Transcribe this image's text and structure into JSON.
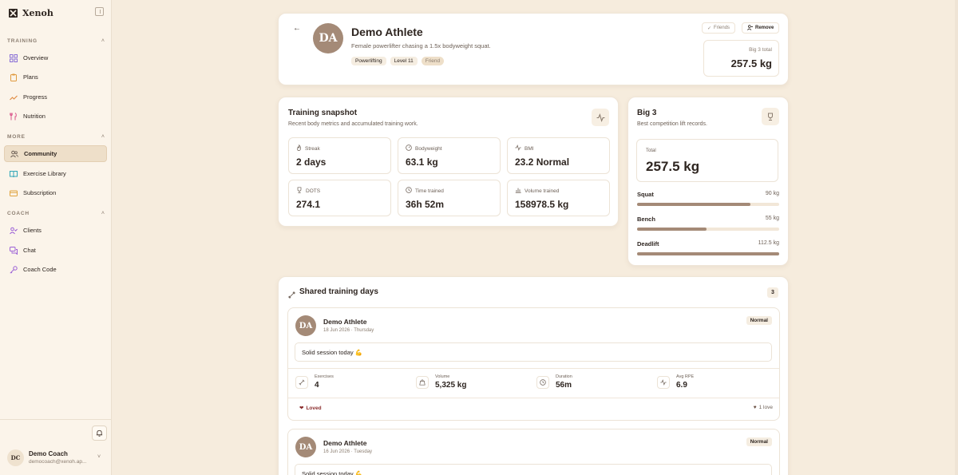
{
  "sidebar": {
    "brand": "Xenoh",
    "sections": {
      "training": "TRAINING",
      "more": "MORE",
      "coach": "COACH"
    },
    "items": [
      {
        "label": "Overview",
        "icon": "grid-icon",
        "color": "#8a6fd6"
      },
      {
        "label": "Plans",
        "icon": "clipboard-icon",
        "color": "#e09a3f"
      },
      {
        "label": "Progress",
        "icon": "trend-icon",
        "color": "#e08a3f"
      },
      {
        "label": "Nutrition",
        "icon": "utensils-icon",
        "color": "#d9538a"
      },
      {
        "label": "Community",
        "icon": "users-icon",
        "color": "#6e6157"
      },
      {
        "label": "Exercise Library",
        "icon": "book-icon",
        "color": "#2ea6b8"
      },
      {
        "label": "Subscription",
        "icon": "card-icon",
        "color": "#e0a33f"
      },
      {
        "label": "Clients",
        "icon": "user-check-icon",
        "color": "#9b5fd6"
      },
      {
        "label": "Chat",
        "icon": "chat-icon",
        "color": "#9b5fd6"
      },
      {
        "label": "Coach Code",
        "icon": "key-icon",
        "color": "#9b5fd6"
      }
    ],
    "user": {
      "initials": "DC",
      "name": "Demo Coach",
      "email": "democoach@xenoh.ap..."
    }
  },
  "profile": {
    "initials": "DA",
    "name": "Demo Athlete",
    "bio": "Female powerlifter chasing a 1.5x bodyweight squat.",
    "tags": [
      "Powerlifting",
      "Level 11",
      "Friend"
    ],
    "friends_label": "Friends",
    "remove_label": "Remove",
    "big3_label": "Big 3 total",
    "big3_value": "257.5 kg"
  },
  "snapshot": {
    "title": "Training snapshot",
    "subtitle": "Recent body metrics and accumulated training work.",
    "metrics": [
      {
        "label": "Streak",
        "value": "2 days",
        "icon": "flame-icon"
      },
      {
        "label": "Bodyweight",
        "value": "63.1 kg",
        "icon": "scale-icon"
      },
      {
        "label": "BMI",
        "value": "23.2 Normal",
        "icon": "pulse-icon"
      },
      {
        "label": "DOTS",
        "value": "274.1",
        "icon": "trophy-icon"
      },
      {
        "label": "Time trained",
        "value": "36h 52m",
        "icon": "clock-icon"
      },
      {
        "label": "Volume trained",
        "value": "158978.5 kg",
        "icon": "bar-chart-icon"
      }
    ]
  },
  "big3": {
    "title": "Big 3",
    "subtitle": "Best competition lift records.",
    "total_label": "Total",
    "total_value": "257.5 kg",
    "lifts": [
      {
        "name": "Squat",
        "value": "90 kg",
        "fraction": 0.8
      },
      {
        "name": "Bench",
        "value": "55 kg",
        "fraction": 0.49
      },
      {
        "name": "Deadlift",
        "value": "112.5 kg",
        "fraction": 1.0
      }
    ]
  },
  "shared": {
    "title": "Shared training days",
    "count": "3",
    "days": [
      {
        "initials": "DA",
        "name": "Demo Athlete",
        "date": "18 Jun 2026 · Thursday",
        "badge": "Normal",
        "note": "Solid session today 💪",
        "stats": [
          {
            "label": "Exercises",
            "value": "4",
            "icon": "dumbbell-icon"
          },
          {
            "label": "Volume",
            "value": "5,325 kg",
            "icon": "weight-icon"
          },
          {
            "label": "Duration",
            "value": "56m",
            "icon": "clock-icon"
          },
          {
            "label": "Avg RPE",
            "value": "6.9",
            "icon": "pulse-icon"
          }
        ],
        "loved_label": "Loved",
        "love_count": "1 love"
      },
      {
        "initials": "DA",
        "name": "Demo Athlete",
        "date": "16 Jun 2026 · Tuesday",
        "badge": "Normal",
        "note": "Solid session today 💪"
      }
    ]
  }
}
